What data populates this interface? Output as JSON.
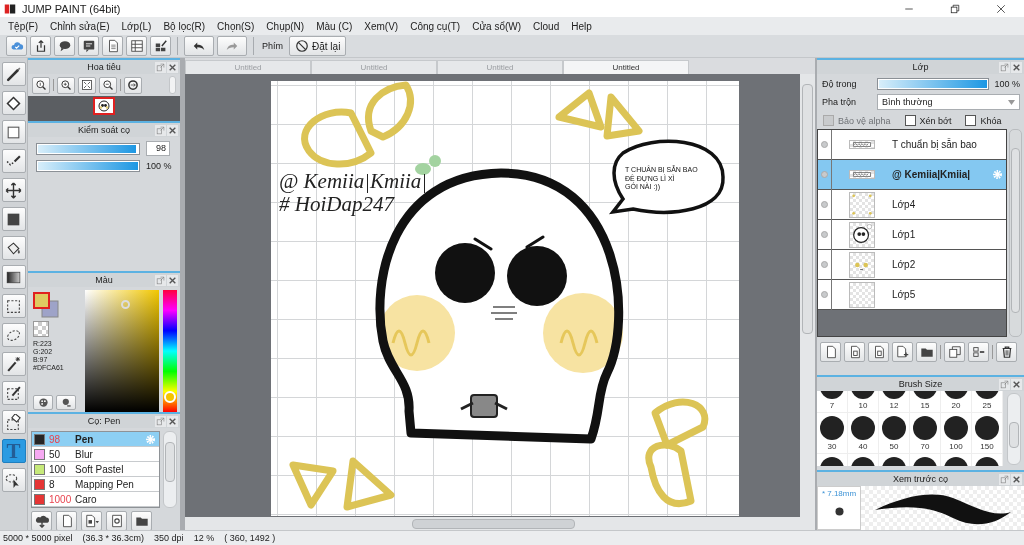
{
  "window": {
    "title": "JUMP PAINT (64bit)"
  },
  "menu": [
    "Tệp(F)",
    "Chỉnh sửa(E)",
    "Lớp(L)",
    "Bộ lọc(R)",
    "Chọn(S)",
    "Chụp(N)",
    "Màu (C)",
    "Xem(V)",
    "Công cụ(T)",
    "Cửa sổ(W)",
    "Cloud",
    "Help"
  ],
  "toolbar": {
    "shortcut_label": "Phím",
    "reset_button": "Đặt lại"
  },
  "tools": [
    {
      "selected": false
    },
    {
      "selected": false
    },
    {
      "selected": false
    },
    {
      "selected": false
    },
    {
      "selected": false
    },
    {
      "selected": false
    },
    {
      "selected": false
    },
    {
      "selected": false
    },
    {
      "selected": false
    },
    {
      "selected": false
    },
    {
      "selected": false
    },
    {
      "selected": false
    },
    {
      "selected": false
    },
    {
      "selected": true,
      "glyph": "T"
    },
    {
      "selected": false
    }
  ],
  "navigator": {
    "title": "Hoa tiêu"
  },
  "brush_control": {
    "title": "Kiểm soát cọ",
    "size": {
      "level": 0.98,
      "value": "98"
    },
    "opacity": {
      "level": 1,
      "reading": "100 %"
    }
  },
  "color": {
    "title": "Màu",
    "readout": [
      "R:223",
      "G:202",
      "B:97",
      "#DFCA61"
    ]
  },
  "brushes": {
    "title": "Cọ: Pen",
    "items": [
      {
        "size": "98",
        "name": "Pen",
        "color": "#262626",
        "flagged": true,
        "selected": true
      },
      {
        "size": "50",
        "name": "Blur",
        "color": "#f6a9f2",
        "flagged": false,
        "selected": false
      },
      {
        "size": "100",
        "name": "Soft Pastel",
        "color": "#c6e97a",
        "flagged": false,
        "selected": false
      },
      {
        "size": "8",
        "name": "Mapping Pen",
        "color": "#e53535",
        "flagged": false,
        "selected": false
      },
      {
        "size": "1000",
        "name": "Caro",
        "color": "#e53535",
        "flagged": true,
        "selected": false
      }
    ]
  },
  "document_tabs": [
    {
      "label": "Untitled",
      "selected": false
    },
    {
      "label": "Untitled",
      "selected": false
    },
    {
      "label": "Untitled",
      "selected": false
    },
    {
      "label": "Untitled",
      "selected": true
    }
  ],
  "canvas": {
    "signature": [
      "@ Kemiia|Kmiia|",
      "# HoiDap247"
    ],
    "speech": [
      "T CHUẨN BỊ SẴN BAO",
      "ĐỂ ĐỰNG LÌ XÌ",
      "GÓI NÀI :))"
    ]
  },
  "layers": {
    "title": "Lớp",
    "opacity_label": "Độ trong",
    "opacity": {
      "level": 1,
      "reading": "100 %"
    },
    "blend_label": "Pha trộn",
    "blend_value": "Bình thường",
    "options": [
      {
        "label": "Bảo vệ alpha",
        "checked": false,
        "disabled": true
      },
      {
        "label": "Xén bớt",
        "checked": false,
        "disabled": false
      },
      {
        "label": "Khóa",
        "checked": false,
        "disabled": false
      }
    ],
    "items": [
      {
        "name": "T chuẩn bị sẵn bao",
        "kind": "text",
        "selected": false
      },
      {
        "name": "@ Kemiia|Kmiia|",
        "kind": "text",
        "selected": true
      },
      {
        "name": "Lớp4",
        "kind": "dots",
        "selected": false
      },
      {
        "name": "Lớp1",
        "kind": "face",
        "selected": false
      },
      {
        "name": "Lớp2",
        "kind": "cheeks",
        "selected": false
      },
      {
        "name": "Lớp5",
        "kind": "blank",
        "selected": false
      }
    ]
  },
  "brush_size": {
    "title": "Brush Size",
    "sizes": [
      "7",
      "10",
      "12",
      "15",
      "20",
      "25",
      "30",
      "40",
      "50",
      "70",
      "100",
      "150"
    ]
  },
  "brush_preview": {
    "title": "Xem trước cọ",
    "size": "* 7.18mm"
  },
  "status": [
    "5000 * 5000 pixel",
    "(36.3 * 36.3cm)",
    "350 dpi",
    "12 %",
    "( 360, 1492 )"
  ]
}
